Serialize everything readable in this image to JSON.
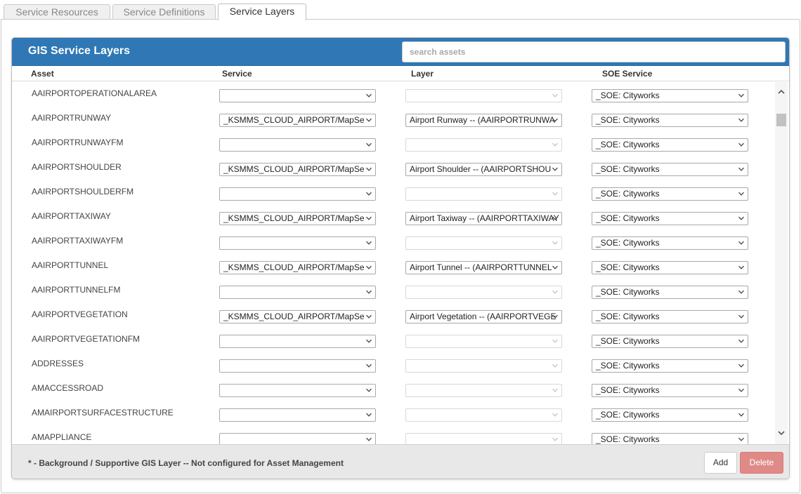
{
  "tabs": [
    {
      "label": "Service Resources",
      "active": false
    },
    {
      "label": "Service Definitions",
      "active": false
    },
    {
      "label": "Service Layers",
      "active": true
    }
  ],
  "panel": {
    "title": "GIS Service Layers",
    "search_placeholder": "search assets",
    "search_value": "",
    "columns": {
      "asset": "Asset",
      "service": "Service",
      "layer": "Layer",
      "soe": "SOE Service"
    }
  },
  "rows": [
    {
      "asset": "AAIRPORTOPERATIONALAREA",
      "service": "",
      "layer": "",
      "layer_enabled": false,
      "soe": "_SOE: Cityworks"
    },
    {
      "asset": "AAIRPORTRUNWAY",
      "service": "_KSMMS_CLOUD_AIRPORT/MapSe",
      "layer": "Airport Runway -- (AAIRPORTRUNWA",
      "layer_enabled": true,
      "soe": "_SOE: Cityworks"
    },
    {
      "asset": "AAIRPORTRUNWAYFM",
      "service": "",
      "layer": "",
      "layer_enabled": false,
      "soe": "_SOE: Cityworks"
    },
    {
      "asset": "AAIRPORTSHOULDER",
      "service": "_KSMMS_CLOUD_AIRPORT/MapSe",
      "layer": "Airport Shoulder -- (AAIRPORTSHOU",
      "layer_enabled": true,
      "soe": "_SOE: Cityworks"
    },
    {
      "asset": "AAIRPORTSHOULDERFM",
      "service": "",
      "layer": "",
      "layer_enabled": false,
      "soe": "_SOE: Cityworks"
    },
    {
      "asset": "AAIRPORTTAXIWAY",
      "service": "_KSMMS_CLOUD_AIRPORT/MapSe",
      "layer": "Airport Taxiway -- (AAIRPORTTAXIWAY",
      "layer_enabled": true,
      "soe": "_SOE: Cityworks"
    },
    {
      "asset": "AAIRPORTTAXIWAYFM",
      "service": "",
      "layer": "",
      "layer_enabled": false,
      "soe": "_SOE: Cityworks"
    },
    {
      "asset": "AAIRPORTTUNNEL",
      "service": "_KSMMS_CLOUD_AIRPORT/MapSe",
      "layer": "Airport Tunnel -- (AAIRPORTTUNNEL",
      "layer_enabled": true,
      "soe": "_SOE: Cityworks"
    },
    {
      "asset": "AAIRPORTTUNNELFM",
      "service": "",
      "layer": "",
      "layer_enabled": false,
      "soe": "_SOE: Cityworks"
    },
    {
      "asset": "AAIRPORTVEGETATION",
      "service": "_KSMMS_CLOUD_AIRPORT/MapSe",
      "layer": "Airport Vegetation -- (AAIRPORTVEGE",
      "layer_enabled": true,
      "soe": "_SOE: Cityworks"
    },
    {
      "asset": "AAIRPORTVEGETATIONFM",
      "service": "",
      "layer": "",
      "layer_enabled": false,
      "soe": "_SOE: Cityworks"
    },
    {
      "asset": "ADDRESSES",
      "service": "",
      "layer": "",
      "layer_enabled": false,
      "soe": "_SOE: Cityworks"
    },
    {
      "asset": "AMACCESSROAD",
      "service": "",
      "layer": "",
      "layer_enabled": false,
      "soe": "_SOE: Cityworks"
    },
    {
      "asset": "AMAIRPORTSURFACESTRUCTURE",
      "service": "",
      "layer": "",
      "layer_enabled": false,
      "soe": "_SOE: Cityworks"
    },
    {
      "asset": "AMAPPLIANCE",
      "service": "",
      "layer": "",
      "layer_enabled": false,
      "soe": "_SOE: Cityworks"
    }
  ],
  "footer": {
    "note": "* - Background / Supportive GIS Layer -- Not configured for Asset Management",
    "add_label": "Add",
    "delete_label": "Delete"
  },
  "colors": {
    "header_blue": "#2f78b5",
    "delete_red": "#e08a87"
  },
  "icons": {
    "dropdown": "chevron-down-icon",
    "scroll_up": "chevron-up-icon",
    "scroll_down": "chevron-down-icon"
  }
}
